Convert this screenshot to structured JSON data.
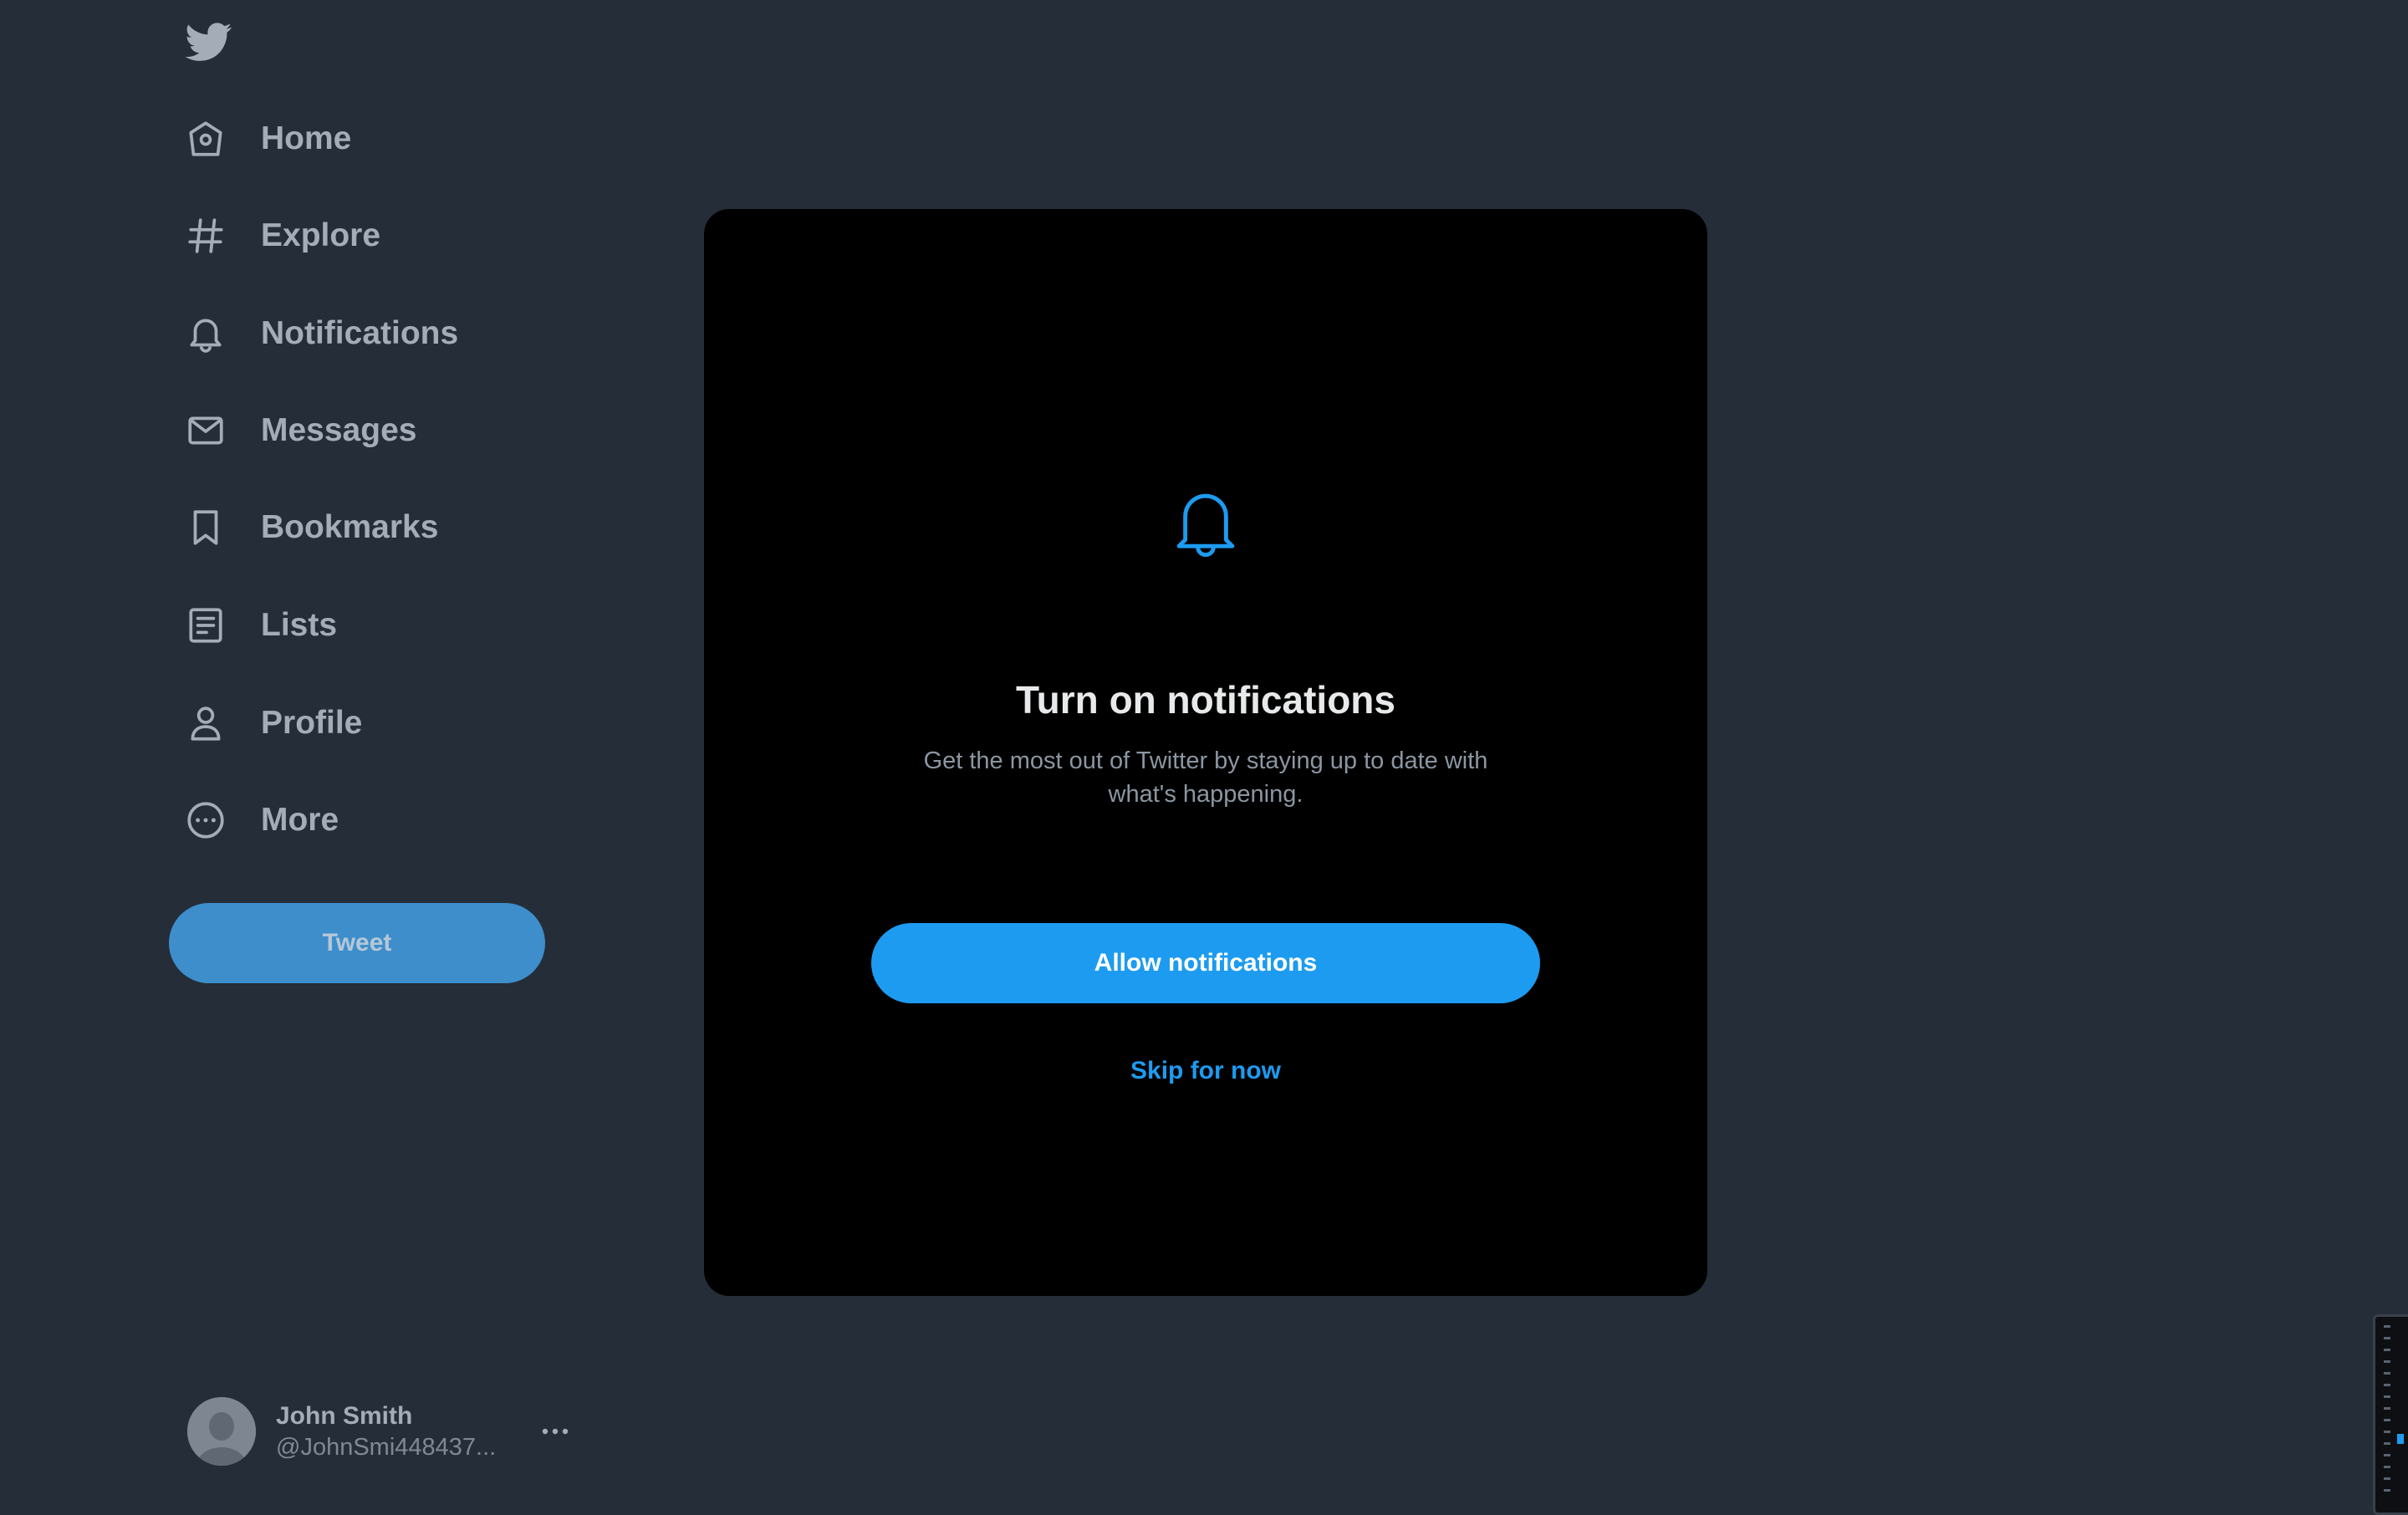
{
  "colors": {
    "background": "#252d38",
    "modal_background": "#000000",
    "accent": "#1d9bf0",
    "tweet_button": "#3d8ecb",
    "nav_text": "#a3acb7",
    "muted_text": "#8b96a2"
  },
  "sidebar": {
    "logo_icon": "twitter-bird-icon",
    "items": [
      {
        "label": "Home",
        "icon": "home-icon"
      },
      {
        "label": "Explore",
        "icon": "hashtag-icon"
      },
      {
        "label": "Notifications",
        "icon": "bell-icon"
      },
      {
        "label": "Messages",
        "icon": "envelope-icon"
      },
      {
        "label": "Bookmarks",
        "icon": "bookmark-icon"
      },
      {
        "label": "Lists",
        "icon": "list-icon"
      },
      {
        "label": "Profile",
        "icon": "person-icon"
      },
      {
        "label": "More",
        "icon": "more-circle-icon"
      }
    ],
    "tweet_label": "Tweet"
  },
  "account": {
    "name": "John Smith",
    "handle": "@JohnSmi448437...",
    "more_icon": "ellipsis-icon"
  },
  "modal": {
    "icon": "bell-icon",
    "title": "Turn on notifications",
    "description": "Get the most out of Twitter by staying up to date with what's happening.",
    "primary_label": "Allow notifications",
    "secondary_label": "Skip for now"
  }
}
